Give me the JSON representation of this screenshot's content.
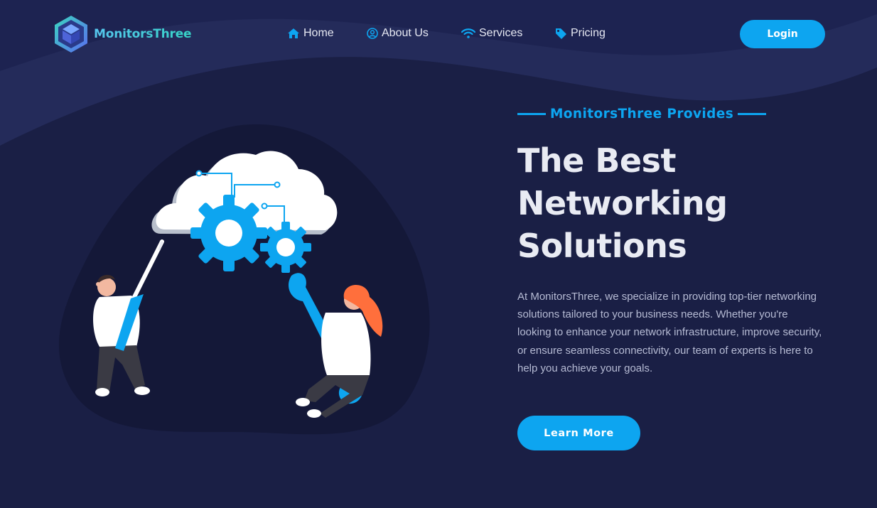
{
  "brand": {
    "name": "MonitorsThree"
  },
  "nav": {
    "items": [
      {
        "label": "Home",
        "icon": "home-icon"
      },
      {
        "label": "About Us",
        "icon": "user-circle-icon"
      },
      {
        "label": "Services",
        "icon": "wifi-icon"
      },
      {
        "label": "Pricing",
        "icon": "tag-icon"
      }
    ],
    "login_label": "Login"
  },
  "hero": {
    "eyebrow": "MonitorsThree Provides",
    "headline_lines": [
      "The Best",
      "Networking",
      "Solutions"
    ],
    "description": "At MonitorsThree, we specialize in providing top-tier networking solutions tailored to your business needs. Whether you're looking to enhance your network infrastructure, improve security, or ensure seamless connectivity, our team of experts is here to help you achieve your goals.",
    "cta_label": "Learn More",
    "illustration": "cloud-gears-team-illustration"
  },
  "colors": {
    "background": "#1a1f45",
    "accent": "#0da5f0",
    "heading": "#e9ebf3",
    "body_text": "#b6bbd4"
  }
}
